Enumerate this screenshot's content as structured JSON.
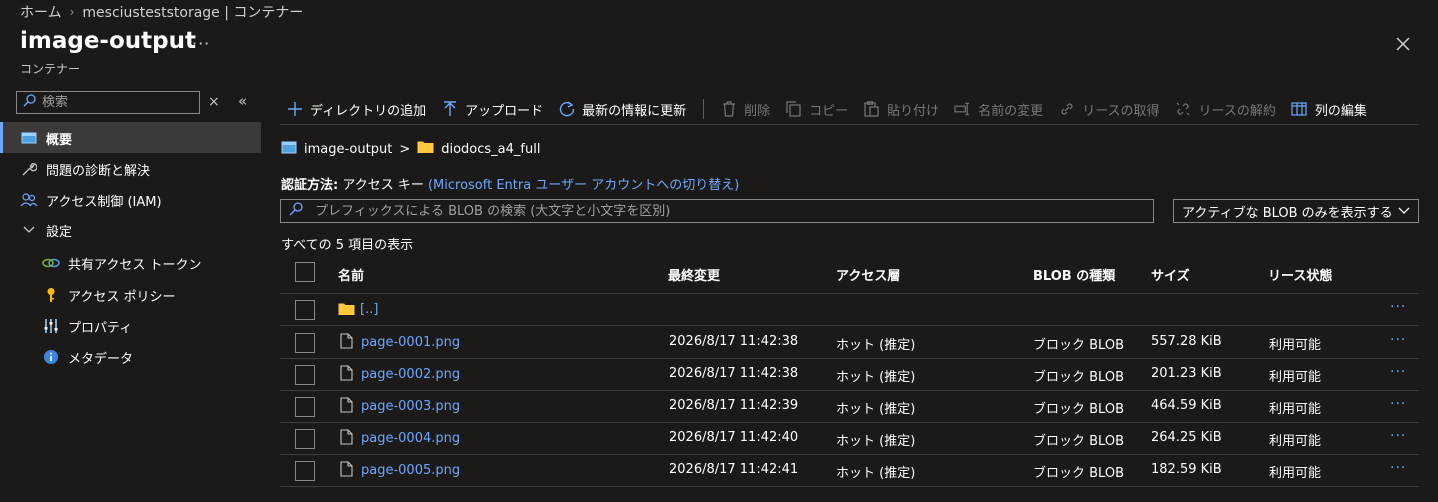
{
  "breadcrumb": {
    "home": "ホーム",
    "sep": "›",
    "current": "mesciusteststorage | コンテナー"
  },
  "header": {
    "title": "image-output",
    "more": "···",
    "subtitle": "コンテナー"
  },
  "sidebar": {
    "search_placeholder": "検索",
    "close": "×",
    "collapse": "«",
    "items": [
      {
        "label": "概要",
        "icon": "container-icon"
      },
      {
        "label": "問題の診断と解決",
        "icon": "wrench-icon"
      },
      {
        "label": "アクセス制御 (IAM)",
        "icon": "people-icon"
      },
      {
        "label": "設定",
        "icon": "chevron-down-icon"
      },
      {
        "label": "共有アクセス トークン",
        "icon": "link-icon"
      },
      {
        "label": "アクセス ポリシー",
        "icon": "key-icon"
      },
      {
        "label": "プロパティ",
        "icon": "sliders-icon"
      },
      {
        "label": "メタデータ",
        "icon": "info-icon"
      }
    ]
  },
  "toolbar": {
    "add_directory": "ディレクトリの追加",
    "upload": "アップロード",
    "refresh": "最新の情報に更新",
    "delete": "削除",
    "copy": "コピー",
    "paste": "貼り付け",
    "rename": "名前の変更",
    "acquire_lease": "リースの取得",
    "break_lease": "リースの解約",
    "edit_columns": "列の編集"
  },
  "path": {
    "container": "image-output",
    "sep": ">",
    "folder": "diodocs_a4_full"
  },
  "auth": {
    "label": "認証方法:",
    "value": "アクセス キー",
    "switch_link": "(Microsoft Entra ユーザー アカウントへの切り替え)"
  },
  "blob_search": {
    "placeholder": "プレフィックスによる BLOB の検索 (大文字と小文字を区別)"
  },
  "filter": {
    "selected": "アクティブな BLOB のみを表示する"
  },
  "count_text": "すべての 5 項目の表示",
  "table": {
    "headers": {
      "name": "名前",
      "modified": "最終変更",
      "tier": "アクセス層",
      "blob_type": "BLOB の種類",
      "size": "サイズ",
      "lease": "リース状態"
    },
    "parent": "[..]",
    "more": "···",
    "rows": [
      {
        "name": "page-0001.png",
        "modified": "2026/8/17 11:42:38",
        "tier": "ホット (推定)",
        "type": "ブロック BLOB",
        "size": "557.28 KiB",
        "lease": "利用可能"
      },
      {
        "name": "page-0002.png",
        "modified": "2026/8/17 11:42:38",
        "tier": "ホット (推定)",
        "type": "ブロック BLOB",
        "size": "201.23 KiB",
        "lease": "利用可能"
      },
      {
        "name": "page-0003.png",
        "modified": "2026/8/17 11:42:39",
        "tier": "ホット (推定)",
        "type": "ブロック BLOB",
        "size": "464.59 KiB",
        "lease": "利用可能"
      },
      {
        "name": "page-0004.png",
        "modified": "2026/8/17 11:42:40",
        "tier": "ホット (推定)",
        "type": "ブロック BLOB",
        "size": "264.25 KiB",
        "lease": "利用可能"
      },
      {
        "name": "page-0005.png",
        "modified": "2026/8/17 11:42:41",
        "tier": "ホット (推定)",
        "type": "ブロック BLOB",
        "size": "182.59 KiB",
        "lease": "利用可能"
      }
    ]
  },
  "colors": {
    "accent": "#6ca8ff",
    "folder": "#ffc83d",
    "background": "#1b1a19",
    "selected": "#3b3a39"
  }
}
